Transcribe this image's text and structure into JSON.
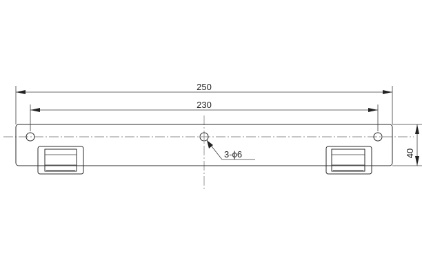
{
  "drawing": {
    "overall_length": "250",
    "hole_spacing": "230",
    "height": "40",
    "hole_callout": "3-ϕ6"
  },
  "colors": {
    "line": "#2a2a2a",
    "centerline": "#6a6a6a",
    "background": "#ffffff"
  }
}
